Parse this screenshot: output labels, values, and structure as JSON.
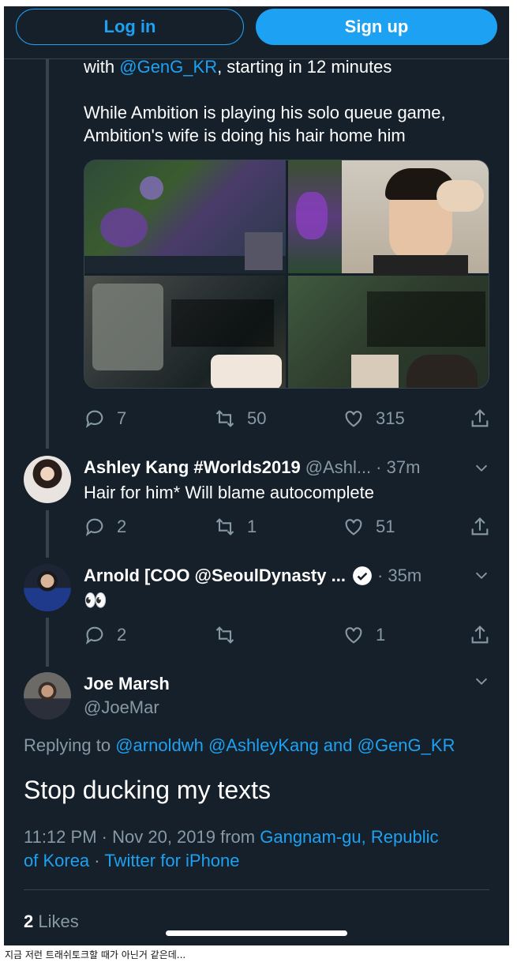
{
  "auth": {
    "login_label": "Log in",
    "signup_label": "Sign up"
  },
  "tweet_top": {
    "line1_prefix": "with ",
    "line1_mention": "@GenG_KR",
    "line1_suffix": ", starting in 12 minutes",
    "line2": "While Ambition is playing his solo queue game,",
    "line3": "Ambition's wife is doing his hair home him",
    "reply_count": "7",
    "retweet_count": "50",
    "like_count": "315"
  },
  "replies": [
    {
      "name": "Ashley Kang #Worlds2019",
      "handle": "@Ashl...",
      "time": "· 37m",
      "text": "Hair for him* Will blame autocomplete",
      "reply_count": "2",
      "retweet_count": "1",
      "like_count": "51"
    },
    {
      "name": "Arnold [COO @SeoulDynasty ...",
      "handle": "",
      "time": "· 35m",
      "text": "👀",
      "reply_count": "2",
      "retweet_count": "",
      "like_count": "1"
    }
  ],
  "main_tweet": {
    "name": "Joe Marsh",
    "handle": "@JoeMar",
    "replying_prefix": "Replying to ",
    "replying_mention1": "@arnoldwh",
    "replying_mention2": "@AshleyKang",
    "replying_and": " and ",
    "replying_mention3": "@GenG_KR",
    "text": "Stop ducking my texts",
    "time": "11:12 PM",
    "date": "Nov 20, 2019",
    "from_label": "from",
    "location_line1": "Gangnam-gu, Republic",
    "location_line2": "of Korea",
    "client": "Twitter for iPhone",
    "likes_count": "2",
    "likes_label": "Likes"
  },
  "caption": "지금 저런 트래쉬토크할 때가 아닌거 같은데...",
  "colors": {
    "background": "#15202b",
    "accent": "#1da1f2",
    "muted": "#8899a6",
    "border": "#38444d"
  },
  "icons": [
    "reply-icon",
    "retweet-icon",
    "like-icon",
    "share-icon",
    "chevron-down-icon",
    "verified-icon"
  ]
}
